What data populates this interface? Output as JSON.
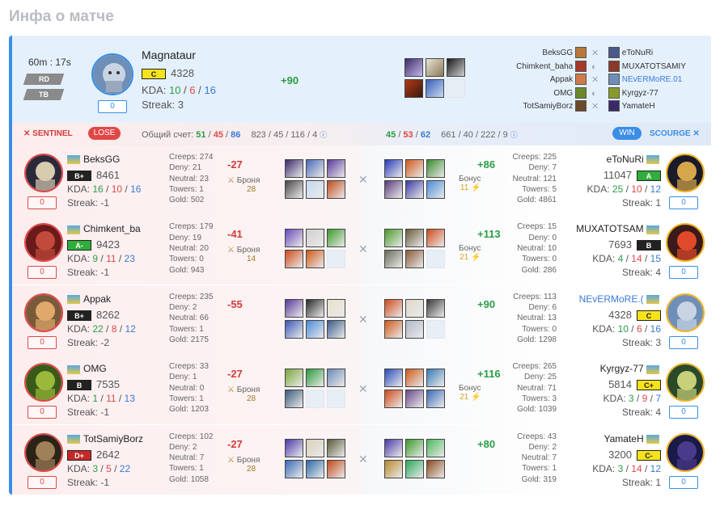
{
  "page_title": "Инфа о матче",
  "header": {
    "duration": "60m : 17s",
    "tags": [
      "RD",
      "TB"
    ],
    "mvp": {
      "name": "Magnataur",
      "rank": "C",
      "mmr": "4328",
      "kda_label": "KDA:",
      "k": "10",
      "d": "6",
      "a": "16",
      "streak": "Streak: 3",
      "score": "0",
      "delta": "+90"
    },
    "left_names": [
      "BeksGG",
      "Chimkent_baha",
      "Appak",
      "OMG",
      "TotSamiyBorz"
    ],
    "right_names": [
      "eToNuRi",
      "MUXATOTSAMIY",
      "NEvERMoRE.01",
      "Kyrgyz-77",
      "YamateH"
    ]
  },
  "bar": {
    "sentinel": "SENTINEL",
    "lose": "LOSE",
    "total_label": "Общий счет:",
    "left_k": "51",
    "left_d": "45",
    "left_a": "86",
    "left_extra": "823 / 45 / 116 / 4",
    "right_k": "45",
    "right_d": "53",
    "right_a": "62",
    "right_extra": "661 / 40 / 222 / 9",
    "win": "WIN",
    "scourge": "SCOURGE"
  },
  "labels": {
    "creeps": "Creeps:",
    "deny": "Deny:",
    "neutral": "Neutral:",
    "towers": "Towers:",
    "gold": "Gold:",
    "kda": "KDA:",
    "armor": "Броня",
    "bonus": "Бонус"
  },
  "rows": [
    {
      "left": {
        "name": "BeksGG",
        "rank": "B+",
        "mmr": "8461",
        "k": "16",
        "d": "10",
        "a": "16",
        "streak": "Streak: -1",
        "score": "0",
        "creeps": "274",
        "deny": "21",
        "neutral": "23",
        "towers": "1",
        "gold": "502",
        "delta": "-27",
        "armor": "28"
      },
      "right": {
        "name": "eToNuRi",
        "rank": "A",
        "mmr": "11047",
        "k": "25",
        "d": "10",
        "a": "12",
        "streak": "Streak: 1",
        "score": "0",
        "creeps": "225",
        "deny": "7",
        "neutral": "121",
        "towers": "5",
        "gold": "4861",
        "delta": "+86",
        "bonus": "11"
      }
    },
    {
      "left": {
        "name": "Chimkent_ba",
        "rank": "A-",
        "mmr": "9423",
        "k": "9",
        "d": "11",
        "a": "23",
        "streak": "Streak: -1",
        "score": "0",
        "creeps": "179",
        "deny": "19",
        "neutral": "20",
        "towers": "0",
        "gold": "943",
        "delta": "-41",
        "armor": "14"
      },
      "right": {
        "name": "MUXATOTSAM",
        "rank": "B",
        "mmr": "7693",
        "k": "4",
        "d": "14",
        "a": "15",
        "streak": "Streak: 4",
        "score": "0",
        "creeps": "15",
        "deny": "0",
        "neutral": "10",
        "towers": "0",
        "gold": "286",
        "delta": "+113",
        "bonus": "21"
      }
    },
    {
      "left": {
        "name": "Appak",
        "rank": "B+",
        "mmr": "8262",
        "k": "22",
        "d": "8",
        "a": "12",
        "streak": "Streak: -2",
        "score": "0",
        "creeps": "235",
        "deny": "2",
        "neutral": "66",
        "towers": "1",
        "gold": "2175",
        "delta": "-55",
        "armor": ""
      },
      "right": {
        "name": "NEvERMoRE.(",
        "rank": "C",
        "mmr": "4328",
        "k": "10",
        "d": "6",
        "a": "16",
        "streak": "Streak: 3",
        "score": "0",
        "creeps": "113",
        "deny": "6",
        "neutral": "13",
        "towers": "0",
        "gold": "1298",
        "delta": "+90",
        "bonus": ""
      }
    },
    {
      "left": {
        "name": "OMG",
        "rank": "B",
        "mmr": "7535",
        "k": "1",
        "d": "11",
        "a": "13",
        "streak": "Streak: -1",
        "score": "0",
        "creeps": "33",
        "deny": "1",
        "neutral": "0",
        "towers": "1",
        "gold": "1203",
        "delta": "-27",
        "armor": "28"
      },
      "right": {
        "name": "Kyrgyz-77",
        "rank": "C+",
        "mmr": "5814",
        "k": "3",
        "d": "9",
        "a": "7",
        "streak": "Streak: 4",
        "score": "0",
        "creeps": "265",
        "deny": "25",
        "neutral": "71",
        "towers": "3",
        "gold": "1039",
        "delta": "+116",
        "bonus": "21"
      }
    },
    {
      "left": {
        "name": "TotSamiyBorz",
        "rank": "D+",
        "mmr": "2642",
        "k": "3",
        "d": "5",
        "a": "22",
        "streak": "Streak: -1",
        "score": "0",
        "creeps": "102",
        "deny": "2",
        "neutral": "7",
        "towers": "1",
        "gold": "1058",
        "delta": "-27",
        "armor": "28"
      },
      "right": {
        "name": "YamateH",
        "rank": "C-",
        "mmr": "3200",
        "k": "3",
        "d": "14",
        "a": "12",
        "streak": "Streak: 1",
        "score": "0",
        "creeps": "43",
        "deny": "2",
        "neutral": "7",
        "towers": "1",
        "gold": "319",
        "delta": "+80",
        "bonus": ""
      }
    }
  ]
}
